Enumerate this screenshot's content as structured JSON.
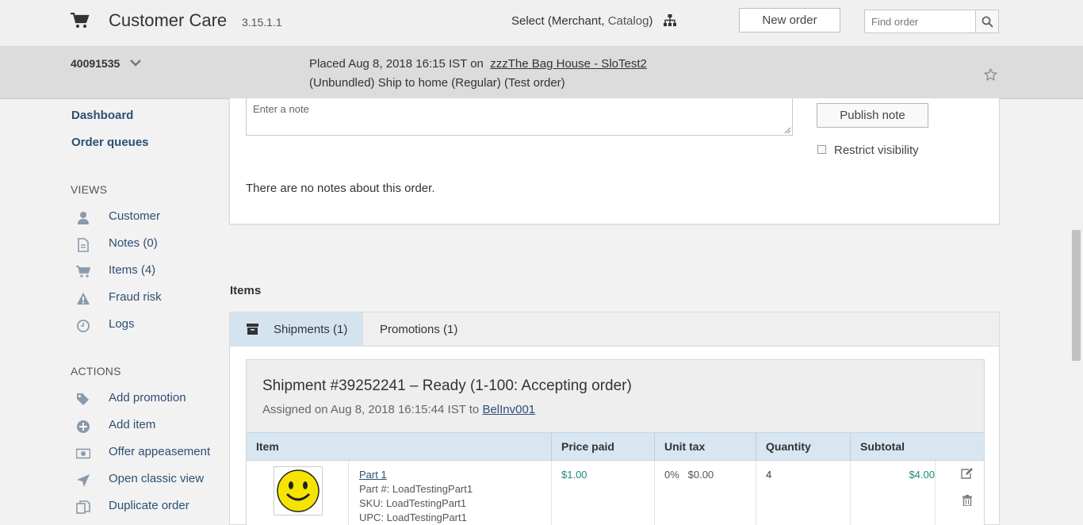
{
  "header": {
    "title": "Customer Care",
    "version": "3.15.1.1",
    "select_prefix": "Select (Merchant, ",
    "select_catalog": "Catalog",
    "select_suffix": ")",
    "new_order_label": "New order",
    "find_placeholder": "Find order"
  },
  "order": {
    "id": "40091535",
    "placed_prefix": "Placed Aug 8, 2018 16:15 IST on",
    "store": "zzzThe Bag House - SloTest2",
    "ship_info": "(Unbundled)  Ship to home (Regular) (Test order)"
  },
  "sidebar": {
    "links": [
      {
        "label": "Dashboard"
      },
      {
        "label": "Order queues"
      }
    ],
    "views_heading": "VIEWS",
    "views": [
      {
        "label": "Customer",
        "icon": "user-icon"
      },
      {
        "label": "Notes (0)",
        "icon": "document-icon"
      },
      {
        "label": "Items (4)",
        "icon": "cart-icon"
      },
      {
        "label": "Fraud risk",
        "icon": "warning-icon"
      },
      {
        "label": "Logs",
        "icon": "clock-icon"
      }
    ],
    "actions_heading": "ACTIONS",
    "actions": [
      {
        "label": "Add promotion",
        "icon": "tags-icon"
      },
      {
        "label": "Add item",
        "icon": "plus-circle-icon"
      },
      {
        "label": "Offer appeasement",
        "icon": "money-icon"
      },
      {
        "label": "Open classic view",
        "icon": "location-arrow-icon"
      },
      {
        "label": "Duplicate order",
        "icon": "copy-icon"
      }
    ]
  },
  "notes": {
    "placeholder": "Enter a note",
    "publish_label": "Publish note",
    "restrict_label": "Restrict visibility",
    "empty_text": "There are no notes about this order."
  },
  "items": {
    "heading": "Items",
    "tabs": [
      {
        "label": "Shipments (1)",
        "active": true
      },
      {
        "label": "Promotions (1)",
        "active": false
      }
    ],
    "shipment": {
      "title": "Shipment #39252241 – Ready (1-100: Accepting order)",
      "assigned_prefix": "Assigned on Aug 8, 2018 16:15:44 IST to ",
      "assigned_to": "BelInv001",
      "columns": [
        "Item",
        "Price paid",
        "Unit tax",
        "Quantity",
        "Subtotal"
      ],
      "rows": [
        {
          "name": "Part 1",
          "part_no": "Part #: LoadTestingPart1",
          "sku": "SKU: LoadTestingPart1",
          "upc": "UPC: LoadTestingPart1",
          "price": "$1.00",
          "tax": "0%   $0.00",
          "quantity": "4",
          "subtotal": "$4.00"
        }
      ]
    }
  },
  "colors": {
    "link": "#2c4f73",
    "money": "#1f8a7a",
    "tab_active": "#d4e4ef",
    "table_header": "#d7e6f0"
  }
}
